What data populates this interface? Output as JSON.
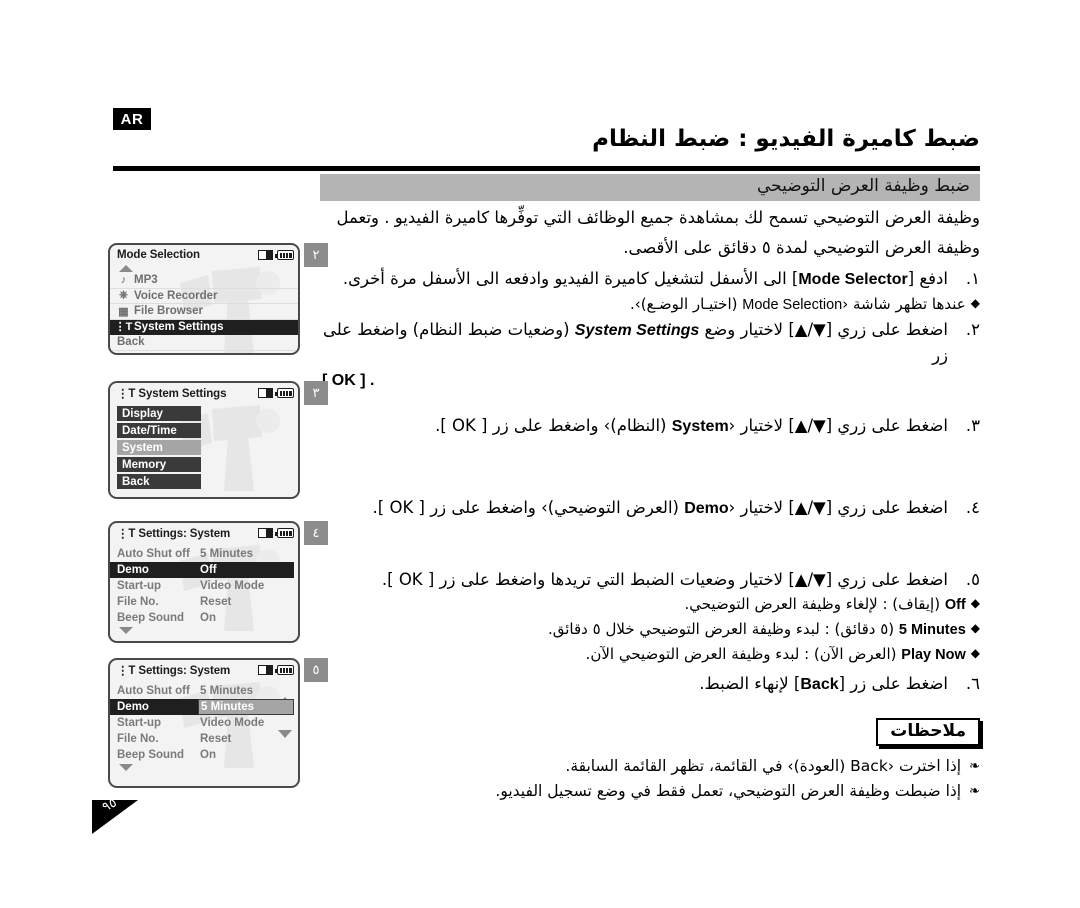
{
  "language_badge": "AR",
  "header": {
    "title": "ضبط كاميرة الفيديو : ضبط النظام",
    "section": "ضبط وظيفة العرض التوضيحي"
  },
  "intro": {
    "line1": "وظيفة العرض التوضيحي تسمح لك بمشاهدة جميع الوظائف التي توفِّرها كاميرة الفيديو . وتعمل",
    "line2": "وظيفة العرض التوضيحي لمدة ٥ دقائق على الأقصى."
  },
  "steps": [
    {
      "num": "١.",
      "pre": "ادفع [",
      "key": "Mode Selector",
      "post": "] الى الأسفل لتشغيل كاميرة الفيديو وادفعه الى الأسفل مرة أخرى.",
      "bullets": [
        {
          "pre": "عندها تظهر شاشة ‹",
          "en": "Mode Selection",
          "post": " (اختيـار الوضـع)›."
        }
      ]
    },
    {
      "num": "٢.",
      "pre": "اضغط على زري [▼/▲] لاختيار وضع ",
      "key": "System Settings",
      "post": " (وضعيات ضبط النظام) واضغط على زر",
      "post2": "[ OK ] ."
    },
    {
      "num": "٣.",
      "pre": "اضغط على زري [▼/▲] لاختيار ‹",
      "key": "System",
      "post": " (النظام)› واضغط على زر [ OK ]."
    },
    {
      "num": "٤.",
      "pre": "اضغط على زري [▼/▲] لاختيار ‹",
      "key": "Demo",
      "post": " (العرض التوضيحي)› واضغط على زر [ OK ]."
    },
    {
      "num": "٥.",
      "pre": "اضغط على زري [▼/▲] لاختيار وضعيات الضبط التي تريدها واضغط على زر [ OK ].",
      "bullets": [
        {
          "en": "Off",
          "post": " (إيقاف) : لإلغاء وظيفة العرض التوضيحي."
        },
        {
          "en": "5 Minutes",
          "post": " (٥ دقائق) : لبدء وظيفة العرض التوضيحي خلال ٥ دقائق."
        },
        {
          "en": "Play Now",
          "post": " (العرض الآن) : لبدء وظيفة العرض التوضيحي الآن."
        }
      ]
    },
    {
      "num": "٦.",
      "pre": "اضغط على زر [",
      "key": "Back",
      "post": "] لإنهاء الضبط."
    }
  ],
  "notes": {
    "heading": "ملاحظات",
    "items": [
      "إذا اخترت ‹Back (العودة)› في القائمة، تظهر القائمة السابقة.",
      "إذا ضبطت وظيفة العرض التوضيحي، تعمل فقط في وضع تسجيل الفيديو."
    ]
  },
  "screens": [
    {
      "badge": "٢",
      "title": "Mode Selection",
      "has_title_icon": false,
      "style": "A",
      "rows": [
        {
          "icon": "music-note-icon",
          "label": "MP3",
          "selected": false
        },
        {
          "icon": "microphone-icon",
          "label": "Voice Recorder",
          "selected": false
        },
        {
          "icon": "file-icon",
          "label": "File Browser",
          "selected": false
        },
        {
          "icon": "settings-icon",
          "label": "System Settings",
          "selected": true
        },
        {
          "icon": "",
          "label": "Back",
          "selected": false
        }
      ]
    },
    {
      "badge": "٣",
      "title": "System Settings",
      "has_title_icon": true,
      "style": "B",
      "rows": [
        {
          "label": "Display",
          "selected": false
        },
        {
          "label": "Date/Time",
          "selected": false
        },
        {
          "label": "System",
          "selected": true
        },
        {
          "label": "Memory",
          "selected": false
        },
        {
          "label": "Back",
          "selected": false
        }
      ]
    },
    {
      "badge": "٤",
      "title": "Settings: System",
      "has_title_icon": true,
      "style": "C",
      "spinner": false,
      "rows": [
        {
          "key": "Auto Shut off",
          "value": "5 Minutes",
          "selected": false
        },
        {
          "key": "Demo",
          "value": "Off",
          "selected": true
        },
        {
          "key": "Start-up",
          "value": "Video Mode",
          "selected": false
        },
        {
          "key": "File No.",
          "value": "Reset",
          "selected": false
        },
        {
          "key": "Beep Sound",
          "value": "On",
          "selected": false
        }
      ]
    },
    {
      "badge": "٥",
      "title": "Settings: System",
      "has_title_icon": true,
      "style": "C",
      "spinner": true,
      "rows": [
        {
          "key": "Auto Shut off",
          "value": "5 Minutes",
          "selected": false
        },
        {
          "key": "Demo",
          "value": "5 Minutes",
          "selected": true
        },
        {
          "key": "Start-up",
          "value": "Video Mode",
          "selected": false
        },
        {
          "key": "File No.",
          "value": "Reset",
          "selected": false
        },
        {
          "key": "Beep Sound",
          "value": "On",
          "selected": false
        }
      ]
    }
  ],
  "page_number": "٩٥",
  "colors": {
    "section_bar": "#b4b4b4",
    "badge_gray": "#8c8c8c",
    "lcd_bg": "#f3f3f3",
    "row_selected": "#1f1f1f",
    "row_chip": "#3a3a3a",
    "row_chip_selected": "#a5a5a5"
  }
}
